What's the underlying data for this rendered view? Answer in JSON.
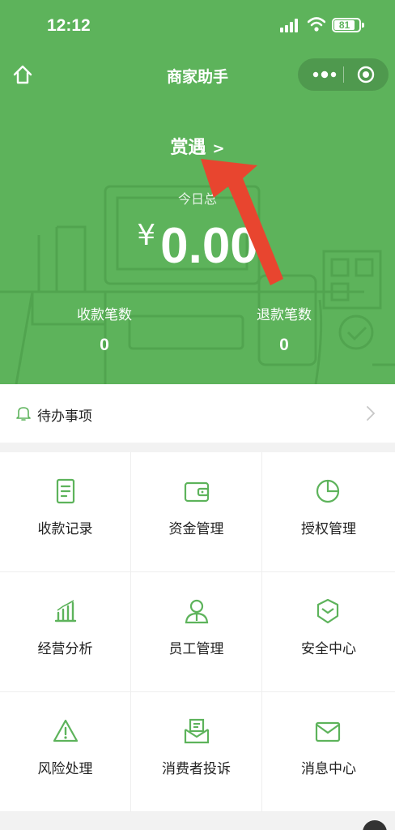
{
  "status": {
    "time": "12:12",
    "battery": "81"
  },
  "nav": {
    "title": "商家助手",
    "home_icon": "home-icon",
    "more_icon": "more-dots-icon",
    "close_icon": "target-icon"
  },
  "header": {
    "merchant_name": "赏遇",
    "chevron": ">",
    "today_label": "今日总",
    "currency": "¥",
    "amount": "0.00",
    "stats": [
      {
        "label": "收款笔数",
        "value": "0"
      },
      {
        "label": "退款笔数",
        "value": "0"
      }
    ],
    "accent_color": "#5db35b",
    "annotation_color": "#e8452f"
  },
  "todo": {
    "label": "待办事项",
    "icon": "bell-icon"
  },
  "grid": [
    {
      "label": "收款记录",
      "icon": "receipt-icon"
    },
    {
      "label": "资金管理",
      "icon": "wallet-icon"
    },
    {
      "label": "授权管理",
      "icon": "pie-chart-icon"
    },
    {
      "label": "经营分析",
      "icon": "bar-chart-icon"
    },
    {
      "label": "员工管理",
      "icon": "user-icon"
    },
    {
      "label": "安全中心",
      "icon": "shield-icon"
    },
    {
      "label": "风险处理",
      "icon": "warning-icon"
    },
    {
      "label": "消费者投诉",
      "icon": "complaint-icon"
    },
    {
      "label": "消息中心",
      "icon": "mail-icon"
    }
  ]
}
